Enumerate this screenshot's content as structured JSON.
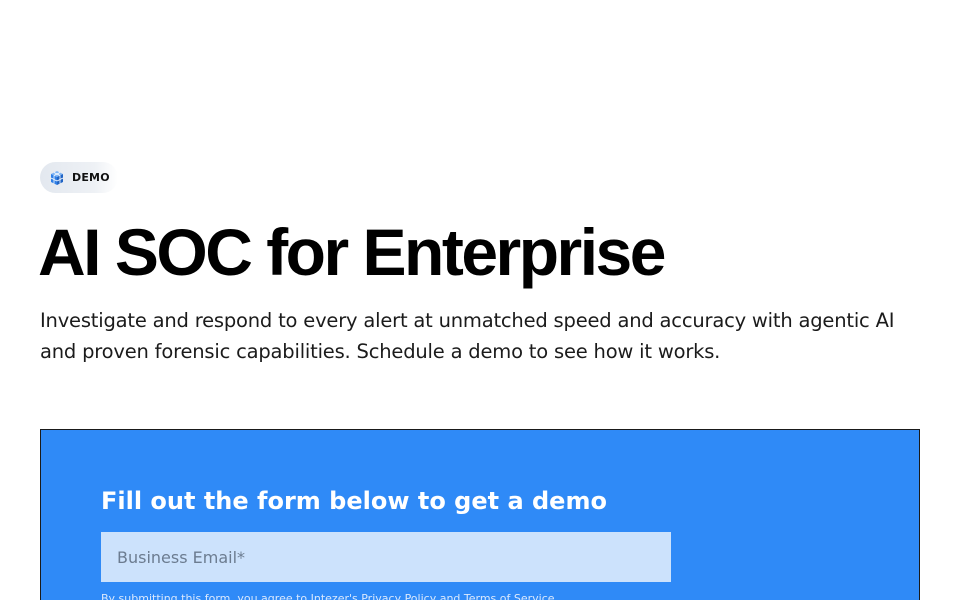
{
  "badge": {
    "label": "DEMO",
    "icon": "cube-grid-icon"
  },
  "hero": {
    "title": "AI SOC for Enterprise",
    "subtitle": "Investigate and respond to every alert at unmatched speed and accuracy with agentic AI and proven forensic capabilities. Schedule a demo to see how it works."
  },
  "form": {
    "heading": "Fill out the form below to get a demo",
    "email_placeholder": "Business Email*",
    "email_value": "",
    "disclaimer": "By submitting this form, you agree to Intezer's Privacy Policy and Terms of Service"
  },
  "colors": {
    "panel": "#2f8af7",
    "input_background": "#cce2fc",
    "badge_icon": "#2f7fe6"
  }
}
